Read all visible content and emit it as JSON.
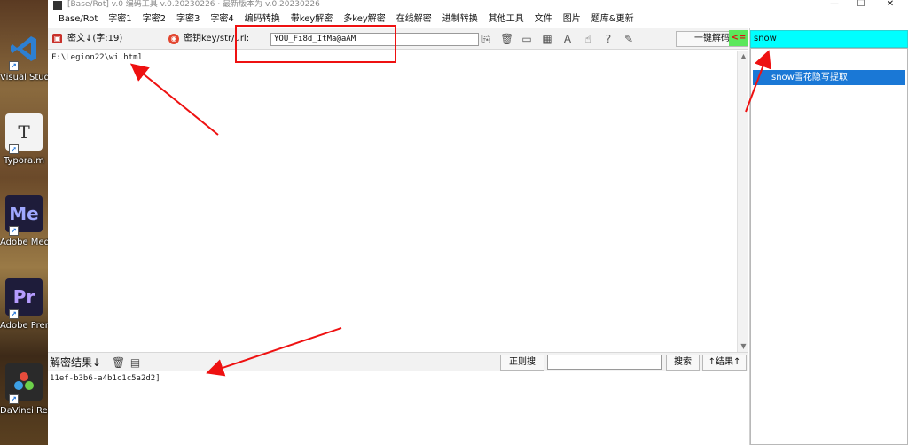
{
  "window": {
    "title": "[Base/Rot] v.0 编码工具 v.0.20230226 · 最新版本为 v.0.20230226"
  },
  "desktop": {
    "icons": [
      {
        "label": "Visual Studio Co",
        "glyph": "",
        "color": "#2d7fd1",
        "icon": "vscode-icon"
      },
      {
        "label": "Typora.m",
        "glyph": "T",
        "color": "#f3f3f3",
        "icon": "typora-icon"
      },
      {
        "label": "Adobe Media...",
        "glyph": "Me",
        "color": "#1e1c3a",
        "icon": "adobe-media-encoder-icon"
      },
      {
        "label": "Adobe Premie...",
        "glyph": "Pr",
        "color": "#1e1c3a",
        "icon": "adobe-premiere-icon"
      },
      {
        "label": "DaVinci Resolve",
        "glyph": "",
        "color": "#2a2a2a",
        "icon": "davinci-resolve-icon"
      }
    ]
  },
  "menu": {
    "items": [
      "Base/Rot",
      "字密1",
      "字密2",
      "字密3",
      "字密4",
      "编码转换",
      "带key解密",
      "多key解密",
      "在线解密",
      "进制转换",
      "其他工具",
      "文件",
      "图片",
      "题库&更新"
    ]
  },
  "toolbar": {
    "cipher_label": "密文↓(字:19)",
    "key_label": "密钥key/str/url:",
    "key_value": "YOU_Fi8d_ItMa@aAM",
    "decode_button": "一键解码",
    "arrow_label": "<="
  },
  "cipher": {
    "text": "F:\\Legion22\\wi.html"
  },
  "result": {
    "label": "解密结果↓",
    "regex_button": "正则搜",
    "search_placeholder": "",
    "search_button": "搜索",
    "result_button": "↑结果↑",
    "text": "11ef-b3b6-a4b1c1c5a2d2]"
  },
  "plugins": {
    "filter_value": "snow",
    "items": [
      "snow雪花隐写提取"
    ]
  },
  "colors": {
    "filter_bg": "#00ffff",
    "selected_bg": "#1a78d6",
    "annotation": "#ee1111"
  }
}
